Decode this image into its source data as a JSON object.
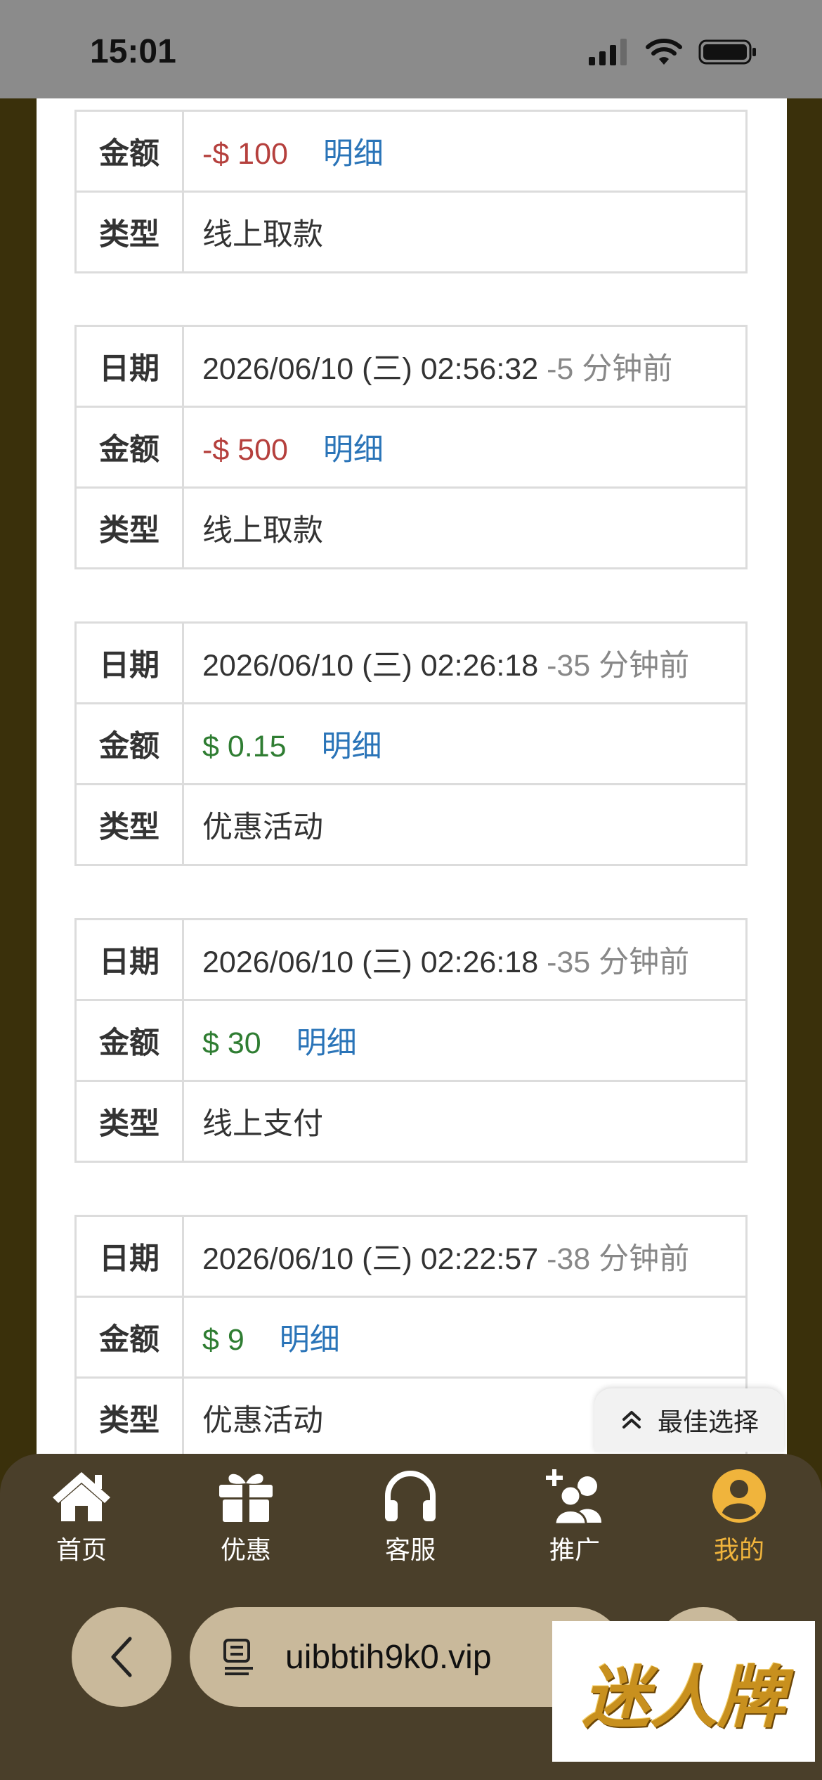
{
  "status_bar": {
    "time": "15:01"
  },
  "records": [
    {
      "amount_sign": "-",
      "amount": "-$ 100",
      "detail": "明细",
      "type": "线上取款",
      "date_visible": false
    },
    {
      "date": "2026/06/10 (三) 02:56:32",
      "ago": "-5 分钟前",
      "amount": "-$ 500",
      "amount_sign": "-",
      "detail": "明细",
      "type": "线上取款"
    },
    {
      "date": "2026/06/10 (三) 02:26:18",
      "ago": "-35 分钟前",
      "amount": "$ 0.15",
      "amount_sign": "+",
      "detail": "明细",
      "type": "优惠活动"
    },
    {
      "date": "2026/06/10 (三) 02:26:18",
      "ago": "-35 分钟前",
      "amount": "$ 30",
      "amount_sign": "+",
      "detail": "明细",
      "type": "线上支付"
    },
    {
      "date": "2026/06/10 (三) 02:22:57",
      "ago": "-38 分钟前",
      "amount": "$ 9",
      "amount_sign": "+",
      "detail": "明细",
      "type": "优惠活动"
    }
  ],
  "labels": {
    "date": "日期",
    "amount": "金额",
    "type": "类型"
  },
  "fab": {
    "label": "最佳选择",
    "icon": "double-chevron-up-icon"
  },
  "tabbar": {
    "items": [
      {
        "label": "首页",
        "icon": "home-icon"
      },
      {
        "label": "优惠",
        "icon": "gift-icon"
      },
      {
        "label": "客服",
        "icon": "headphones-icon"
      },
      {
        "label": "推广",
        "icon": "add-user-icon"
      },
      {
        "label": "我的",
        "icon": "user-circle-icon",
        "active": true
      }
    ]
  },
  "browser": {
    "url": "uibbtih9k0.vip"
  },
  "logo": {
    "text": "迷人牌"
  },
  "colors": {
    "negative": "#b5403d",
    "positive": "#2f7d32",
    "link": "#2a74b8",
    "active_tab": "#f0b43c",
    "tab_bg": "#4a3f2a"
  }
}
